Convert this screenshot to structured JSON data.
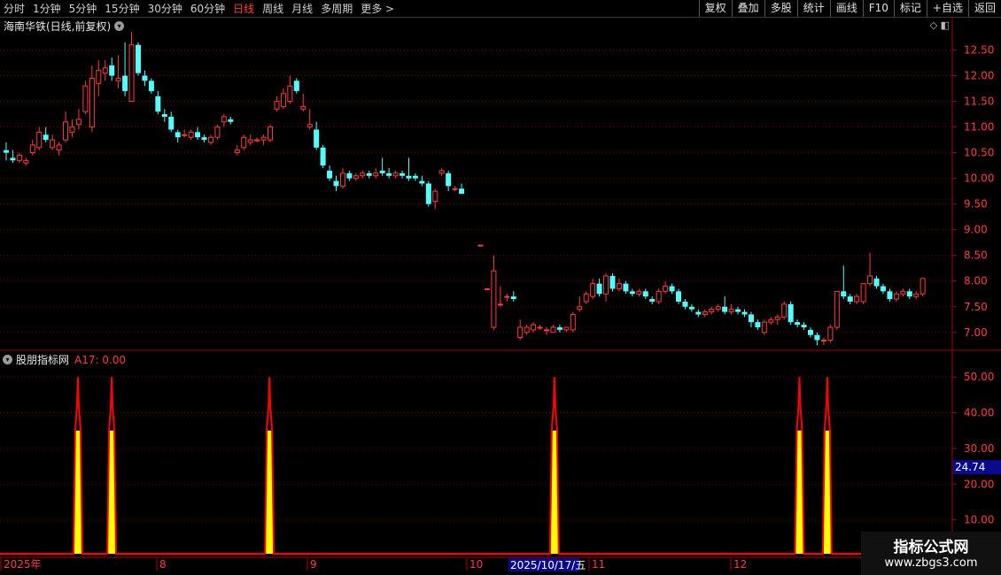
{
  "toolbar": {
    "periods": [
      "分时",
      "1分钟",
      "5分钟",
      "15分钟",
      "30分钟",
      "60分钟",
      "日线",
      "周线",
      "月线",
      "多周期",
      "更多 >"
    ],
    "active_period": "日线",
    "actions": [
      "复权",
      "叠加",
      "多股",
      "统计",
      "画线",
      "F10",
      "标记",
      "+自选",
      "返回"
    ]
  },
  "main_chart": {
    "title": "海南华铁(日线,前复权)",
    "price_ticks": [
      "12.50",
      "12.00",
      "11.50",
      "11.00",
      "10.50",
      "10.00",
      "9.50",
      "9.00",
      "8.50",
      "8.00",
      "7.50",
      "7.00"
    ],
    "colors": {
      "up": "#ff3b3b",
      "down": "#54ffff",
      "grid": "#7a0000"
    }
  },
  "indicator": {
    "name": "股朋指标网",
    "value_label": "A17: 0.00",
    "ticks": [
      "50.00",
      "40.00",
      "30.00",
      "20.00",
      "10.00"
    ],
    "cursor_value": "24.74",
    "colors": {
      "line": "#ff0000",
      "fill": "#ffff00"
    }
  },
  "date_axis": {
    "labels": [
      "2025年",
      "8",
      "9",
      "10",
      "11",
      "12"
    ],
    "highlight": "2025/10/17/五"
  },
  "watermark": {
    "line1": "指标公式网",
    "line2": "www.zbgs3.com"
  },
  "chart_data": {
    "type": "candlestick",
    "y_range": [
      6.6,
      12.75
    ],
    "candles": [
      [
        10.55,
        10.7,
        10.35,
        10.5
      ],
      [
        10.4,
        10.55,
        10.3,
        10.35
      ],
      [
        10.35,
        10.5,
        10.3,
        10.45
      ],
      [
        10.3,
        10.4,
        10.25,
        10.35
      ],
      [
        10.5,
        10.75,
        10.45,
        10.65
      ],
      [
        10.6,
        11.0,
        10.55,
        10.9
      ],
      [
        10.85,
        11.0,
        10.7,
        10.75
      ],
      [
        10.6,
        10.85,
        10.55,
        10.75
      ],
      [
        10.55,
        10.7,
        10.45,
        10.65
      ],
      [
        10.75,
        11.3,
        10.7,
        11.1
      ],
      [
        10.9,
        11.15,
        10.8,
        11.0
      ],
      [
        11.05,
        11.35,
        10.95,
        11.15
      ],
      [
        11.3,
        11.9,
        11.25,
        11.8
      ],
      [
        11.0,
        12.2,
        10.9,
        11.95
      ],
      [
        11.85,
        12.3,
        11.6,
        12.1
      ],
      [
        12.05,
        12.3,
        11.9,
        12.15
      ],
      [
        12.2,
        12.35,
        11.9,
        12.0
      ],
      [
        11.9,
        12.4,
        11.75,
        11.95
      ],
      [
        12.0,
        12.65,
        11.6,
        11.7
      ],
      [
        11.5,
        12.85,
        11.5,
        12.6
      ],
      [
        12.6,
        12.65,
        12.0,
        12.05
      ],
      [
        12.0,
        12.1,
        11.8,
        11.9
      ],
      [
        11.9,
        11.95,
        11.65,
        11.7
      ],
      [
        11.6,
        11.7,
        11.25,
        11.3
      ],
      [
        11.25,
        11.35,
        11.1,
        11.2
      ],
      [
        11.2,
        11.3,
        10.9,
        10.95
      ],
      [
        10.9,
        10.95,
        10.7,
        10.8
      ],
      [
        10.85,
        10.95,
        10.8,
        10.85
      ],
      [
        10.8,
        10.95,
        10.75,
        10.9
      ],
      [
        10.9,
        11.0,
        10.75,
        10.8
      ],
      [
        10.8,
        10.85,
        10.7,
        10.75
      ],
      [
        10.7,
        10.85,
        10.65,
        10.8
      ],
      [
        10.8,
        11.05,
        10.75,
        11.0
      ],
      [
        11.1,
        11.25,
        11.0,
        11.2
      ],
      [
        11.15,
        11.2,
        11.05,
        11.1
      ],
      [
        10.5,
        10.65,
        10.45,
        10.55
      ],
      [
        10.6,
        10.85,
        10.55,
        10.8
      ],
      [
        10.7,
        10.85,
        10.65,
        10.75
      ],
      [
        10.75,
        10.8,
        10.7,
        10.75
      ],
      [
        10.75,
        10.85,
        10.65,
        10.8
      ],
      [
        10.75,
        11.05,
        10.7,
        11.0
      ],
      [
        11.35,
        11.6,
        11.3,
        11.5
      ],
      [
        11.4,
        11.75,
        11.35,
        11.65
      ],
      [
        11.5,
        12.0,
        11.45,
        11.8
      ],
      [
        11.9,
        11.95,
        11.65,
        11.7
      ],
      [
        11.35,
        11.65,
        11.3,
        11.4
      ],
      [
        11.0,
        11.35,
        10.95,
        11.05
      ],
      [
        10.95,
        11.1,
        10.55,
        10.6
      ],
      [
        10.6,
        10.65,
        10.2,
        10.25
      ],
      [
        10.15,
        10.25,
        9.95,
        10.0
      ],
      [
        9.95,
        10.05,
        9.75,
        9.85
      ],
      [
        9.85,
        10.2,
        9.8,
        10.1
      ],
      [
        10.1,
        10.15,
        9.95,
        10.0
      ],
      [
        10.0,
        10.1,
        9.95,
        10.05
      ],
      [
        10.05,
        10.15,
        10.0,
        10.1
      ],
      [
        10.1,
        10.15,
        10.0,
        10.05
      ],
      [
        10.05,
        10.2,
        10.0,
        10.1
      ],
      [
        10.15,
        10.4,
        10.05,
        10.1
      ],
      [
        10.1,
        10.2,
        10.0,
        10.05
      ],
      [
        10.05,
        10.15,
        10.0,
        10.1
      ],
      [
        10.1,
        10.15,
        10.0,
        10.05
      ],
      [
        10.05,
        10.4,
        9.95,
        10.0
      ],
      [
        10.05,
        10.1,
        9.95,
        10.0
      ],
      [
        9.95,
        10.05,
        9.85,
        9.9
      ],
      [
        9.9,
        9.95,
        9.45,
        9.5
      ],
      [
        9.55,
        9.8,
        9.4,
        9.75
      ],
      [
        10.1,
        10.2,
        10.05,
        10.15
      ],
      [
        10.1,
        10.15,
        9.75,
        9.85
      ],
      [
        9.8,
        9.85,
        9.75,
        9.8
      ],
      [
        9.8,
        9.9,
        9.7,
        9.7
      ],
      [
        8.7,
        8.7,
        8.7,
        8.7
      ],
      [
        7.85,
        7.85,
        7.85,
        7.85
      ],
      [
        7.1,
        8.5,
        7.05,
        8.2
      ],
      [
        7.55,
        7.9,
        7.5,
        7.55
      ],
      [
        7.7,
        7.75,
        7.6,
        7.7
      ],
      [
        7.7,
        7.8,
        7.6,
        7.65
      ],
      [
        6.9,
        7.25,
        6.85,
        7.1
      ],
      [
        7.0,
        7.15,
        6.95,
        7.1
      ],
      [
        7.05,
        7.2,
        7.0,
        7.15
      ],
      [
        7.1,
        7.15,
        7.05,
        7.1
      ],
      [
        7.05,
        7.1,
        6.95,
        7.05
      ],
      [
        7.0,
        7.15,
        7.0,
        7.1
      ],
      [
        7.1,
        7.15,
        7.0,
        7.05
      ],
      [
        7.05,
        7.1,
        7.0,
        7.1
      ],
      [
        7.05,
        7.4,
        7.0,
        7.35
      ],
      [
        7.45,
        7.7,
        7.4,
        7.5
      ],
      [
        7.6,
        7.8,
        7.55,
        7.75
      ],
      [
        7.7,
        8.05,
        7.65,
        7.95
      ],
      [
        7.95,
        8.05,
        7.7,
        7.75
      ],
      [
        7.75,
        8.15,
        7.6,
        8.1
      ],
      [
        8.1,
        8.15,
        7.8,
        7.85
      ],
      [
        7.85,
        8.05,
        7.8,
        7.95
      ],
      [
        7.95,
        8.0,
        7.75,
        7.8
      ],
      [
        7.8,
        7.85,
        7.7,
        7.75
      ],
      [
        7.75,
        7.85,
        7.7,
        7.8
      ],
      [
        7.8,
        7.85,
        7.65,
        7.7
      ],
      [
        7.65,
        7.7,
        7.55,
        7.6
      ],
      [
        7.6,
        7.85,
        7.55,
        7.8
      ],
      [
        7.8,
        8.0,
        7.75,
        7.9
      ],
      [
        7.9,
        7.95,
        7.75,
        7.8
      ],
      [
        7.8,
        7.85,
        7.55,
        7.6
      ],
      [
        7.6,
        7.65,
        7.45,
        7.5
      ],
      [
        7.5,
        7.55,
        7.4,
        7.45
      ],
      [
        7.4,
        7.45,
        7.3,
        7.35
      ],
      [
        7.35,
        7.45,
        7.3,
        7.4
      ],
      [
        7.4,
        7.5,
        7.35,
        7.45
      ],
      [
        7.45,
        7.55,
        7.4,
        7.5
      ],
      [
        7.5,
        7.7,
        7.35,
        7.4
      ],
      [
        7.4,
        7.55,
        7.35,
        7.45
      ],
      [
        7.45,
        7.5,
        7.35,
        7.4
      ],
      [
        7.4,
        7.45,
        7.3,
        7.35
      ],
      [
        7.35,
        7.4,
        7.1,
        7.2
      ],
      [
        7.2,
        7.25,
        7.05,
        7.1
      ],
      [
        7.0,
        7.25,
        6.95,
        7.2
      ],
      [
        7.2,
        7.3,
        7.15,
        7.25
      ],
      [
        7.25,
        7.35,
        7.15,
        7.3
      ],
      [
        7.3,
        7.6,
        7.25,
        7.55
      ],
      [
        7.55,
        7.6,
        7.15,
        7.2
      ],
      [
        7.2,
        7.25,
        7.1,
        7.15
      ],
      [
        7.15,
        7.2,
        7.05,
        7.1
      ],
      [
        7.05,
        7.1,
        6.9,
        6.95
      ],
      [
        6.95,
        7.0,
        6.75,
        6.85
      ],
      [
        6.85,
        6.9,
        6.75,
        6.85
      ],
      [
        6.85,
        7.15,
        6.8,
        7.1
      ],
      [
        7.1,
        7.8,
        7.05,
        7.8
      ],
      [
        7.8,
        8.3,
        7.65,
        7.7
      ],
      [
        7.7,
        7.75,
        7.55,
        7.6
      ],
      [
        7.6,
        7.75,
        7.55,
        7.7
      ],
      [
        7.6,
        7.85,
        7.55,
        7.95
      ],
      [
        7.95,
        8.55,
        7.9,
        8.1
      ],
      [
        8.05,
        8.1,
        7.85,
        7.9
      ],
      [
        7.9,
        7.95,
        7.75,
        7.8
      ],
      [
        7.8,
        7.85,
        7.6,
        7.65
      ],
      [
        7.65,
        7.8,
        7.6,
        7.75
      ],
      [
        7.75,
        7.85,
        7.7,
        7.8
      ],
      [
        7.8,
        7.85,
        7.65,
        7.7
      ],
      [
        7.7,
        7.8,
        7.65,
        7.75
      ],
      [
        7.75,
        8.05,
        7.7,
        8.05
      ]
    ],
    "indicator_spikes": {
      "peak": 50,
      "plateau": 35,
      "positions": [
        0.0818,
        0.1173,
        0.2829,
        0.5822,
        0.8395,
        0.8687
      ]
    },
    "indicator_y_range": [
      0,
      55
    ]
  }
}
